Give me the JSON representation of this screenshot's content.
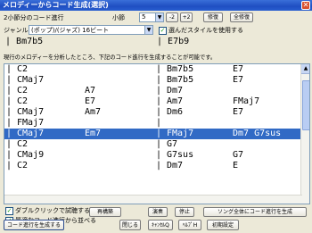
{
  "window": {
    "title": "メロディーからコード生成(選択)"
  },
  "controls": {
    "chord_per_bar_label": "2小節分のコード進行",
    "measure_label": "小節",
    "measure_value": "5",
    "minus2": "-2",
    "plus2": "+2",
    "fix_btn": "修復",
    "fix_all_btn": "全修復",
    "genre_label": "ジャンル",
    "genre_value": "(ポップ)/(ジャズ) 16ビート",
    "apply_style_label": "選んだスタイルを使用する"
  },
  "current": {
    "chord1": "Bm7b5",
    "chord2": "E7b9"
  },
  "info_text": "現行のメロディーを分析したところ、下記のコード進行を生成することが可能です。",
  "rows": [
    {
      "c1": "C2",
      "c2": "",
      "c3": "Bm7b5",
      "c4": "E7",
      "sel": false
    },
    {
      "c1": "CMaj7",
      "c2": "",
      "c3": "Bm7b5",
      "c4": "E7",
      "sel": false
    },
    {
      "c1": "C2",
      "c2": "A7",
      "c3": "Dm7",
      "c4": "",
      "sel": false
    },
    {
      "c1": "C2",
      "c2": "E7",
      "c3": "Am7",
      "c4": "FMaj7",
      "sel": false
    },
    {
      "c1": "CMaj7",
      "c2": "Am7",
      "c3": "Dm6",
      "c4": "E7",
      "sel": false
    },
    {
      "c1": "FMaj7",
      "c2": "",
      "c3": "",
      "c4": "",
      "sel": false
    },
    {
      "c1": "CMaj7",
      "c2": "Em7",
      "c3": "FMaj7",
      "c4": "Dm7 G7sus",
      "sel": true
    },
    {
      "c1": "C2",
      "c2": "",
      "c3": "G7",
      "c4": "",
      "sel": false
    },
    {
      "c1": "CMaj9",
      "c2": "",
      "c3": "G7sus",
      "c4": "G7",
      "sel": false
    },
    {
      "c1": "C2",
      "c2": "",
      "c3": "Dm7",
      "c4": "E",
      "sel": false
    }
  ],
  "options": {
    "dbl_click_label": "ダブルクリックで試聴する",
    "sort_label": "最適なコード進行から並べる"
  },
  "buttons": {
    "regen": "再構築",
    "play": "演奏",
    "stop": "停止",
    "song_gen": "ソング全体にコード進行を生成",
    "generate": "コード進行を生成する",
    "close": "閉じる",
    "cancel": "ｷｬﾝｾﾙQ",
    "help": "ﾍﾙﾌﾟH",
    "defaults": "初期設定"
  }
}
